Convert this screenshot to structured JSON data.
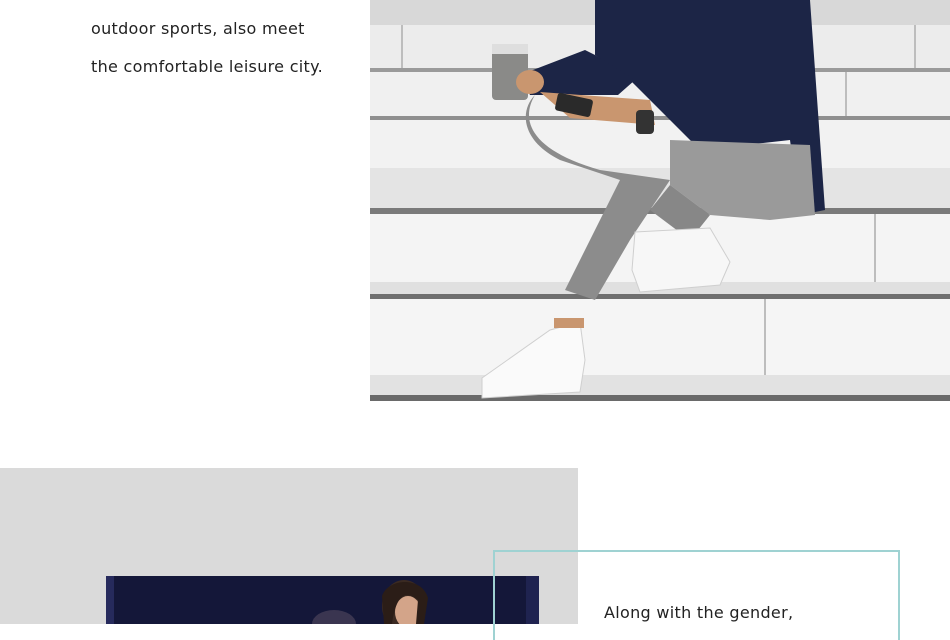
{
  "top_text": {
    "line1": "outdoor sports, also meet",
    "line2": "the comfortable leisure city."
  },
  "bottom_text": {
    "line1": "Along with the gender,"
  },
  "colors": {
    "background": "#ffffff",
    "grey_panel": "#dadada",
    "frame_border": "#9fd2d2",
    "text": "#222222"
  }
}
